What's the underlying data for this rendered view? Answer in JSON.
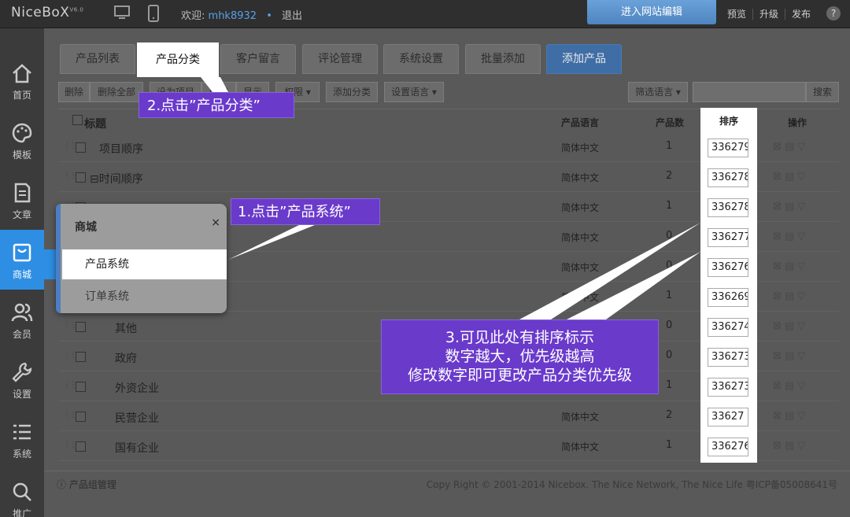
{
  "topbar": {
    "logo": "NiceBoX",
    "version": "V6.0",
    "welcome_label": "欢迎:",
    "username": "mhk8932",
    "logout": "退出",
    "enter_editor": "进入网站编辑",
    "links": [
      "预览",
      "升级",
      "发布"
    ],
    "help": "?"
  },
  "sidebar": {
    "items": [
      {
        "label": "首页",
        "icon": "home-icon"
      },
      {
        "label": "模板",
        "icon": "palette-icon"
      },
      {
        "label": "文章",
        "icon": "document-icon"
      },
      {
        "label": "商城",
        "icon": "shop-icon",
        "active": true
      },
      {
        "label": "会员",
        "icon": "users-icon"
      },
      {
        "label": "设置",
        "icon": "wrench-icon"
      },
      {
        "label": "系统",
        "icon": "list-icon"
      },
      {
        "label": "推广",
        "icon": "search-icon"
      }
    ]
  },
  "tabs": [
    {
      "label": "产品列表"
    },
    {
      "label": "产品分类",
      "active": true
    },
    {
      "label": "客户留言"
    },
    {
      "label": "评论管理"
    },
    {
      "label": "系统设置"
    },
    {
      "label": "批量添加"
    },
    {
      "label": "添加产品",
      "primary": true
    }
  ],
  "toolbar": {
    "delete": "删除",
    "delete_all": "删除全部",
    "set_item": "设为项目",
    "hide": "隐藏",
    "show": "显示",
    "permission": "权限",
    "add_category": "添加分类",
    "set_language": "设置语言",
    "filter_language": "筛选语言",
    "search": "搜索"
  },
  "table": {
    "headers": {
      "title": "标题",
      "language": "产品语言",
      "count": "产品数",
      "sort": "排序",
      "actions": "操作"
    },
    "rows": [
      {
        "name": "项目顺序",
        "language": "简体中文",
        "count": "1",
        "sort": "336279"
      },
      {
        "name": "⊟时间顺序",
        "language": "简体中文",
        "count": "2",
        "sort": "336278"
      },
      {
        "name": "",
        "language": "简体中文",
        "count": "1",
        "sort": "336278"
      },
      {
        "name": "",
        "language": "简体中文",
        "count": "0",
        "sort": "336277"
      },
      {
        "name": "",
        "language": "简体中文",
        "count": "0",
        "sort": "336276"
      },
      {
        "name": "",
        "language": "简体中文",
        "count": "1",
        "sort": "336269"
      },
      {
        "name": "其他",
        "language": "",
        "count": "0",
        "sort": "336274"
      },
      {
        "name": "政府",
        "language": "",
        "count": "0",
        "sort": "336273"
      },
      {
        "name": "外资企业",
        "language": "",
        "count": "1",
        "sort": "336273"
      },
      {
        "name": "民营企业",
        "language": "简体中文",
        "count": "2",
        "sort": "33627"
      },
      {
        "name": "国有企业",
        "language": "简体中文",
        "count": "1",
        "sort": "336276"
      }
    ]
  },
  "popup": {
    "title": "商城",
    "close": "×",
    "items": [
      "产品系统",
      "订单系统"
    ]
  },
  "footer": {
    "left": "产品组管理",
    "right": "Copy Right © 2001-2014 Nicebox. The Nice Network, The Nice Life 粤ICP备05008641号"
  },
  "callouts": {
    "step1": "1.点击”产品系统”",
    "step2": "2.点击”产品分类”",
    "step3_line1": "3.可见此处有排序标示",
    "step3_line2": "数字越大，优先级越高",
    "step3_line3": "修改数字即可更改产品分类优先级"
  }
}
